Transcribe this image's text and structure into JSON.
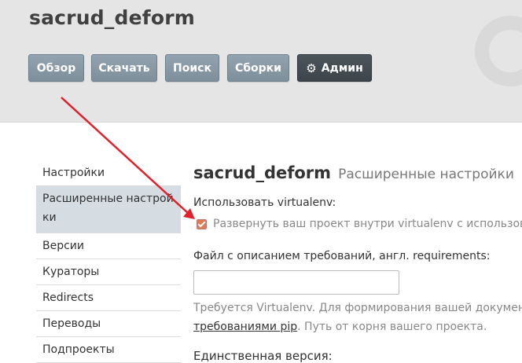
{
  "header": {
    "project_title": "sacrud_deform",
    "nav": [
      {
        "label": "Обзор"
      },
      {
        "label": "Скачать"
      },
      {
        "label": "Поиск"
      },
      {
        "label": "Сборки"
      },
      {
        "label": "Админ",
        "icon": "gear-icon"
      }
    ]
  },
  "sidebar": {
    "items": [
      {
        "label": "Настройки"
      },
      {
        "label": "Расширенные настрой ки",
        "active": true
      },
      {
        "label": "Версии"
      },
      {
        "label": "Кураторы"
      },
      {
        "label": "Redirects"
      },
      {
        "label": "Переводы"
      },
      {
        "label": "Подпроекты"
      }
    ]
  },
  "main": {
    "heading_project": "sacrud_deform",
    "heading_sub": "Расширенные настройки",
    "virtualenv_label": "Использовать virtualenv:",
    "virtualenv_checkbox_label": "Развернуть ваш проект внутри virtualenv с использов",
    "virtualenv_checked": true,
    "requirements_label": "Файл с описанием требований, англ. requirements:",
    "requirements_value": "",
    "help_line1": "Требуется Virtualenv. Для формирования вашей докумен",
    "help_link": "требованиями pip",
    "help_line2_rest": ". Путь от корня вашего проекта.",
    "single_version_label": "Единственная версия:"
  },
  "colors": {
    "header_bg": "#e5e5e5",
    "nav_button": "#8797a4",
    "admin_button": "#444c52",
    "sidebar_active": "#d5dde2",
    "annotation_arrow": "#e0202a"
  }
}
